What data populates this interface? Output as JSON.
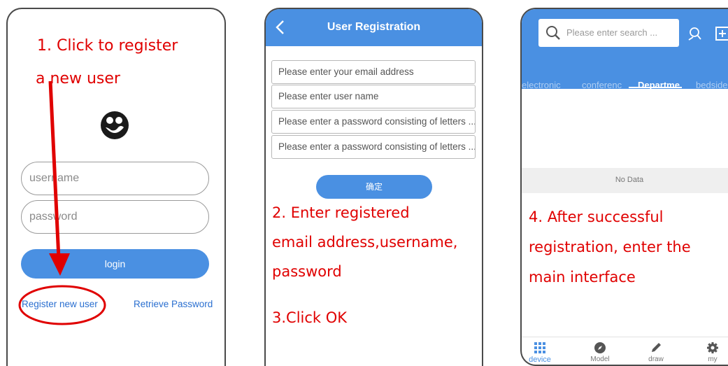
{
  "panel1": {
    "step_note_line1": "1.   Click to register",
    "step_note_line2": "a new user",
    "username_placeholder": "username",
    "password_placeholder": "password",
    "login_label": "login",
    "register_link": "Register new user",
    "retrieve_link": "Retrieve Password",
    "icons": {
      "logo": "smiley-logo-icon"
    }
  },
  "panel2": {
    "header_title": "User Registration",
    "fields": [
      "Please enter your email address",
      "Please enter user name",
      "Please enter a password consisting of letters ...",
      "Please enter a password consisting of letters ..."
    ],
    "ok_label": "确定",
    "step2_line1": "2.   Enter registered",
    "step2_line2": "email address,username,",
    "step2_line3": "password",
    "step3": "3.Click OK",
    "icons": {
      "back": "chevron-left-icon"
    }
  },
  "panel3": {
    "search_placeholder": "Please enter search ...",
    "tabs": [
      "electronic",
      "conferenc",
      "Departme",
      "bedside s"
    ],
    "active_tab": "Departme",
    "empty_text": "No Data",
    "step4_line1": "4.   After successful",
    "step4_line2": "registration, enter the",
    "step4_line3": "main interface",
    "bottom_nav": [
      "device",
      "Model",
      "draw",
      "my"
    ],
    "icons": {
      "search": "search-icon",
      "user_search": "user-search-icon",
      "add": "plus-box-icon"
    }
  },
  "colors": {
    "accent": "#4a90e2",
    "annotation": "#e00000"
  }
}
